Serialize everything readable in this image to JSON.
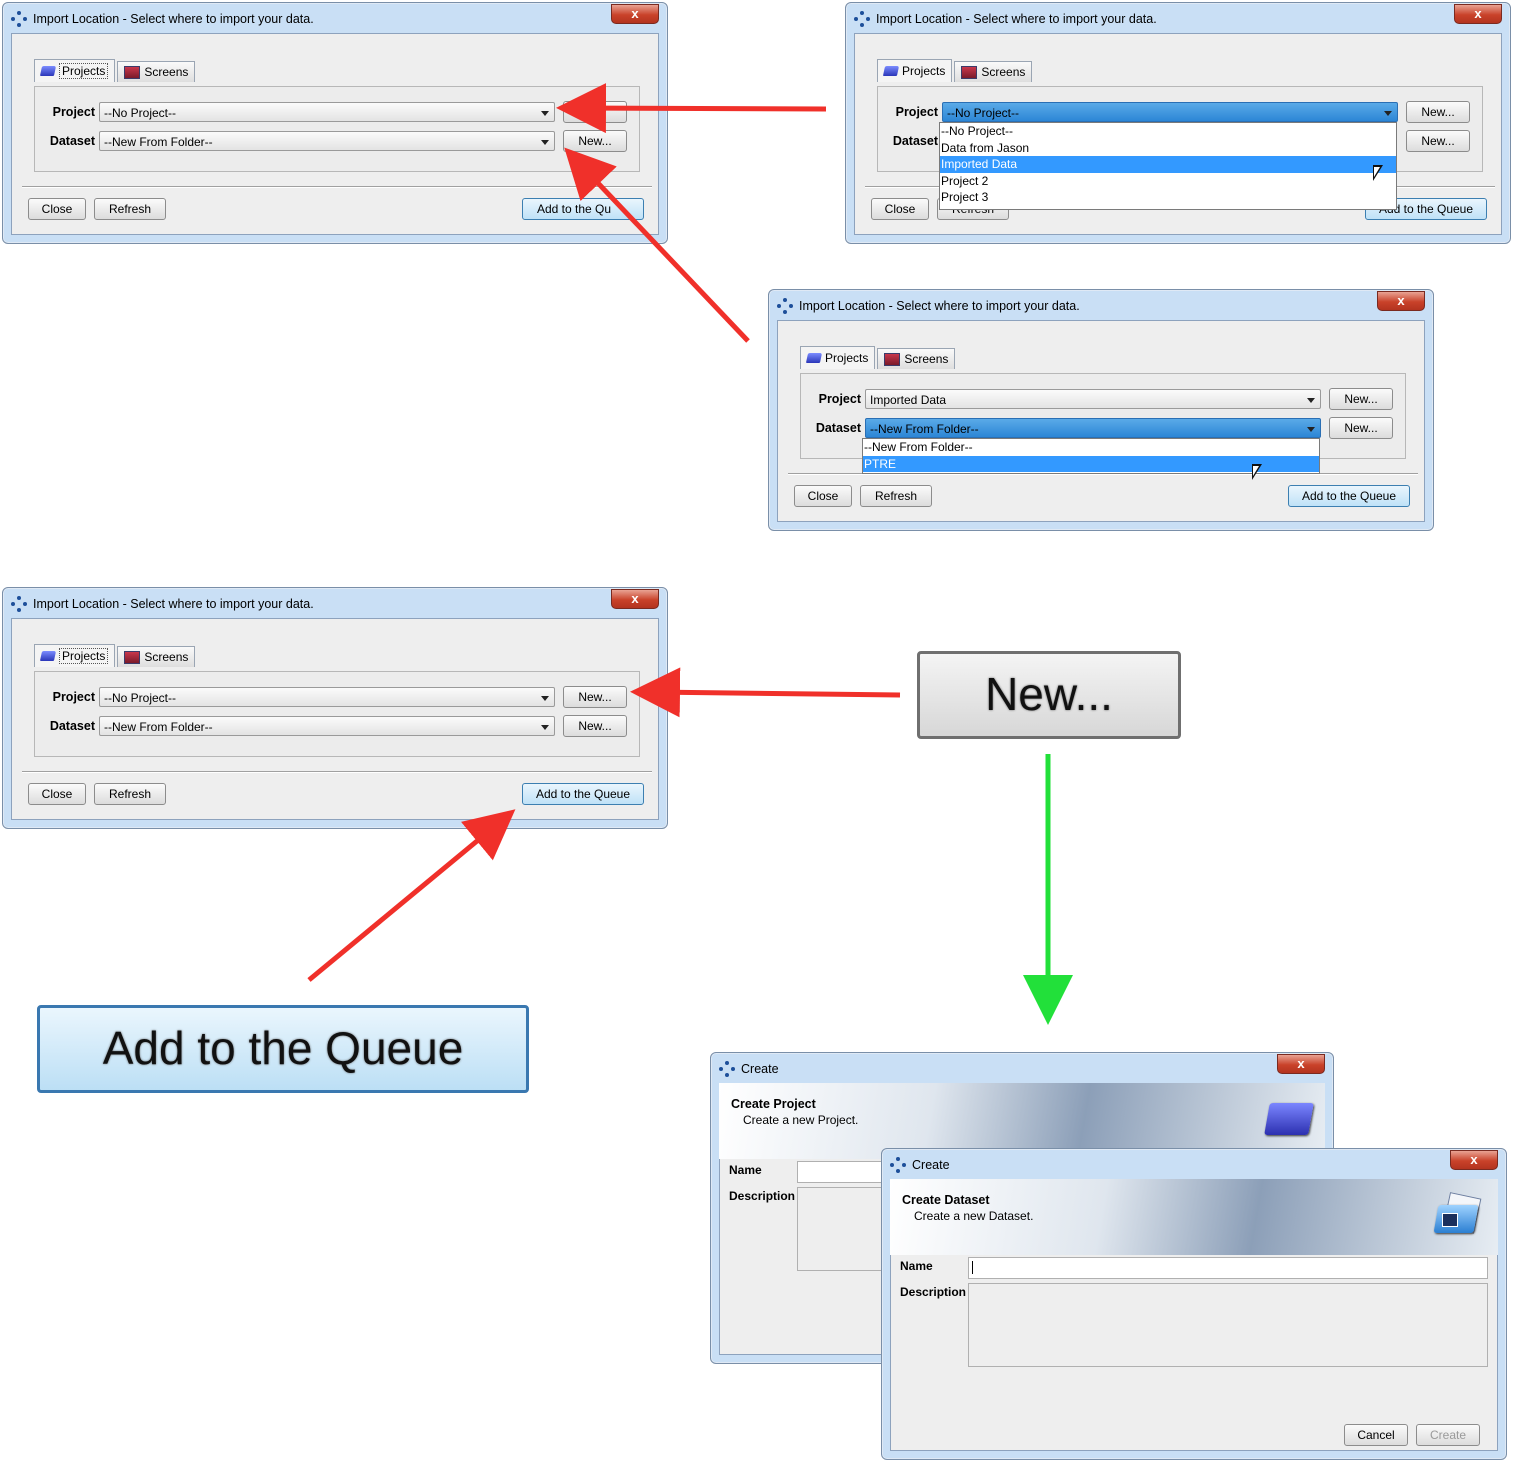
{
  "import_dialog": {
    "title": "Import Location - Select where to import your data.",
    "close_glyph": "x",
    "tabs": [
      "Projects",
      "Screens"
    ],
    "project_label": "Project",
    "dataset_label": "Dataset",
    "new_button": "New...",
    "close_button": "Close",
    "refresh_button": "Refresh",
    "queue_button": "Add to the Queue",
    "queue_button_partial": "Add to the Qu",
    "refresh_partial": "Refresh"
  },
  "dialog1": {
    "project_value": "--No Project--",
    "dataset_value": "--New From Folder--"
  },
  "dialog2": {
    "project_value": "--No Project--",
    "project_options": [
      "--No Project--",
      "Data from Jason",
      "Imported Data",
      "Project 2",
      "Project 3"
    ],
    "selected_option": "Imported Data"
  },
  "dialog3": {
    "project_value": "Imported Data",
    "dataset_value": "--New From Folder--",
    "dataset_options": [
      "--New From Folder--",
      "PTRE"
    ],
    "selected_option": "PTRE"
  },
  "dialog4": {
    "project_value": "--No Project--",
    "dataset_value": "--New From Folder--"
  },
  "zoom": {
    "new_label": "New...",
    "queue_label": "Add to the Queue"
  },
  "create_project": {
    "window_title": "Create",
    "header_title": "Create Project",
    "header_subtitle": "Create a new Project.",
    "name_label": "Name",
    "description_label": "Description"
  },
  "create_dataset": {
    "window_title": "Create",
    "header_title": "Create Dataset",
    "header_subtitle": "Create a new Dataset.",
    "name_label": "Name",
    "description_label": "Description",
    "cancel_button": "Cancel",
    "create_button": "Create"
  },
  "colors": {
    "red_arrow": "#f0302a",
    "green_arrow": "#22e03a",
    "selection": "#3399ff"
  },
  "icons": [
    "app-icon",
    "close-icon",
    "projects-folder-icon",
    "screens-icon",
    "chevron-down-icon",
    "mouse-cursor-icon",
    "folder-icon",
    "dataset-icon"
  ]
}
